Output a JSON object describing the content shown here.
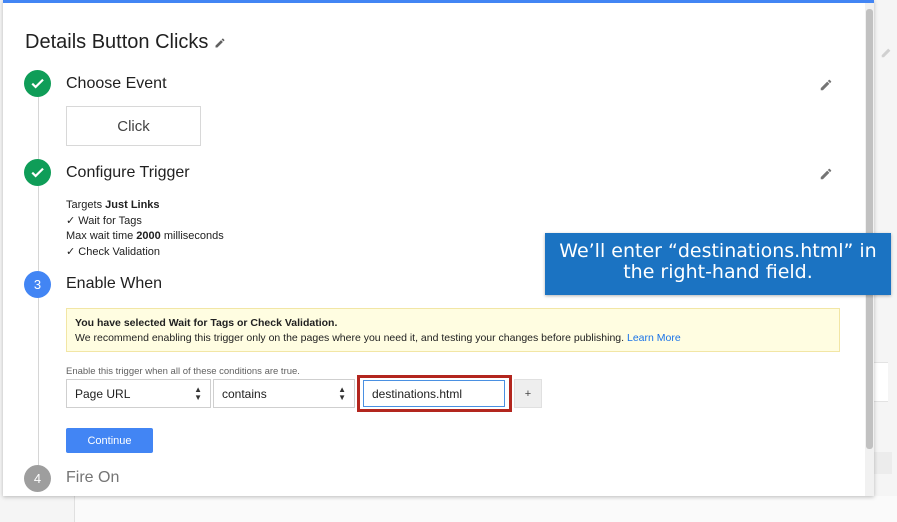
{
  "header": {
    "title": "Details Button Clicks"
  },
  "steps": [
    {
      "number": "✓",
      "title": "Choose Event",
      "state": "done"
    },
    {
      "number": "✓",
      "title": "Configure Trigger",
      "state": "done"
    },
    {
      "number": "3",
      "title": "Enable When",
      "state": "active"
    },
    {
      "number": "4",
      "title": "Fire On",
      "state": "pending"
    }
  ],
  "choose_event": {
    "value": "Click"
  },
  "configure_trigger": {
    "targets_prefix": "Targets ",
    "targets_value": "Just Links",
    "wait_for_tags": "✓ Wait for Tags",
    "max_wait_prefix": "Max wait time ",
    "max_wait_value": "2000",
    "max_wait_suffix": " milliseconds",
    "check_validation": "✓ Check Validation"
  },
  "enable_when": {
    "notice_title": "You have selected Wait for Tags or Check Validation.",
    "notice_body": "We recommend enabling this trigger only on the pages where you need it, and testing your changes before publishing. ",
    "notice_link": "Learn More",
    "conditions_label": "Enable this trigger when all of these conditions are true.",
    "variable_select": "Page URL",
    "operator_select": "contains",
    "value_input": "destinations.html",
    "add_button": "+",
    "continue_button": "Continue"
  },
  "callout": {
    "line1": "We’ll enter “destinations.html” in",
    "line2": "the right-hand field."
  },
  "colors": {
    "accent_blue": "#4285f4",
    "done_green": "#0f9d58",
    "highlight_red": "#b3261e",
    "callout_blue": "#1b73c2"
  },
  "icons": [
    "pencil-icon",
    "check-icon",
    "select-arrow-icon"
  ]
}
